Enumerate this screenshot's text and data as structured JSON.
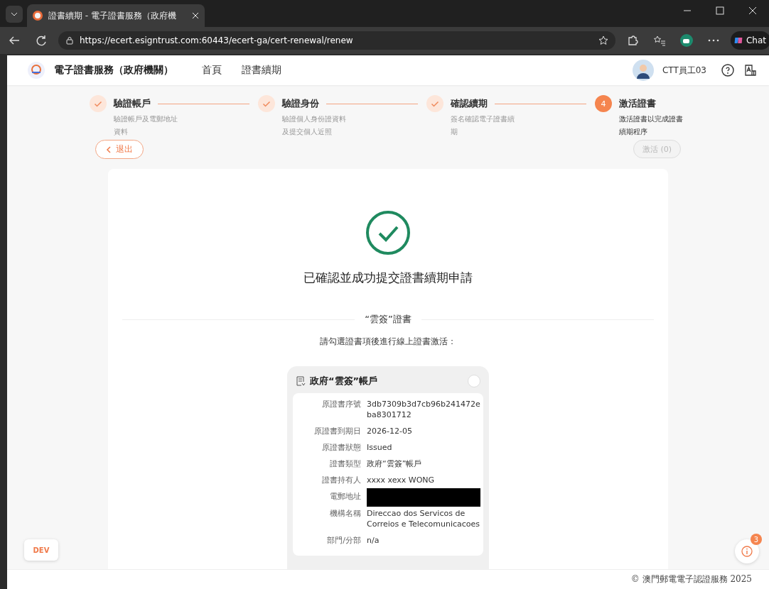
{
  "browser": {
    "tab_title": "證書續期 - 電子證書服務（政府機",
    "url": "https://ecert.esigntrust.com:60443/ecert-ga/cert-renewal/renew",
    "side_button": "Chat"
  },
  "header": {
    "app_title": "電子證書服務（政府機關）",
    "nav": [
      {
        "label": "首頁",
        "selected": false
      },
      {
        "label": "證書續期",
        "selected": false
      }
    ],
    "user_name": "CTT員工03"
  },
  "steps": [
    {
      "kind": "done",
      "title": "驗證帳戶",
      "description": "驗證帳戶及電郵地址資料"
    },
    {
      "kind": "done",
      "title": "驗證身份",
      "description": "驗證個人身份證資料及提交個人近照"
    },
    {
      "kind": "done",
      "title": "確認續期",
      "description": "簽名確認電子證書續期"
    },
    {
      "kind": "current",
      "number": "4",
      "title": "激活證書",
      "description": "激活證書以完成證書續期程序"
    }
  ],
  "actions": {
    "back": {
      "label": "退出"
    },
    "activate": {
      "label": "激活 (0)",
      "disabled": true
    }
  },
  "result": {
    "message": "已確認並成功提交證書續期申請",
    "section_title": "“雲簽”證書",
    "instruction": "請勾選證書項後進行線上證書激活："
  },
  "certificate": {
    "title": "政府“雲簽”帳戶",
    "selected": false,
    "fields": [
      {
        "kind": "text",
        "label": "原證書序號",
        "value": "3db7309b3d7cb96b241472eba8301712"
      },
      {
        "kind": "text",
        "label": "原證書到期日",
        "value": "2026-12-05"
      },
      {
        "kind": "text",
        "label": "原證書狀態",
        "value": "Issued"
      },
      {
        "kind": "text",
        "label": "證書類型",
        "value": "政府“雲簽”帳戶"
      },
      {
        "kind": "text",
        "label": "證書持有人",
        "value": "xxxx xexx WONG"
      },
      {
        "kind": "redacted",
        "label": "電郵地址"
      },
      {
        "kind": "text",
        "label": "機構名稱",
        "value": "Direccao dos Servicos de Correios e Telecomunicacoes"
      },
      {
        "kind": "text",
        "label": "部門/分部",
        "value": "n/a"
      }
    ]
  },
  "env_badge": "DEV",
  "notifications": {
    "count": "3"
  },
  "footer": "© 澳門郵電電子認證服務 2025"
}
